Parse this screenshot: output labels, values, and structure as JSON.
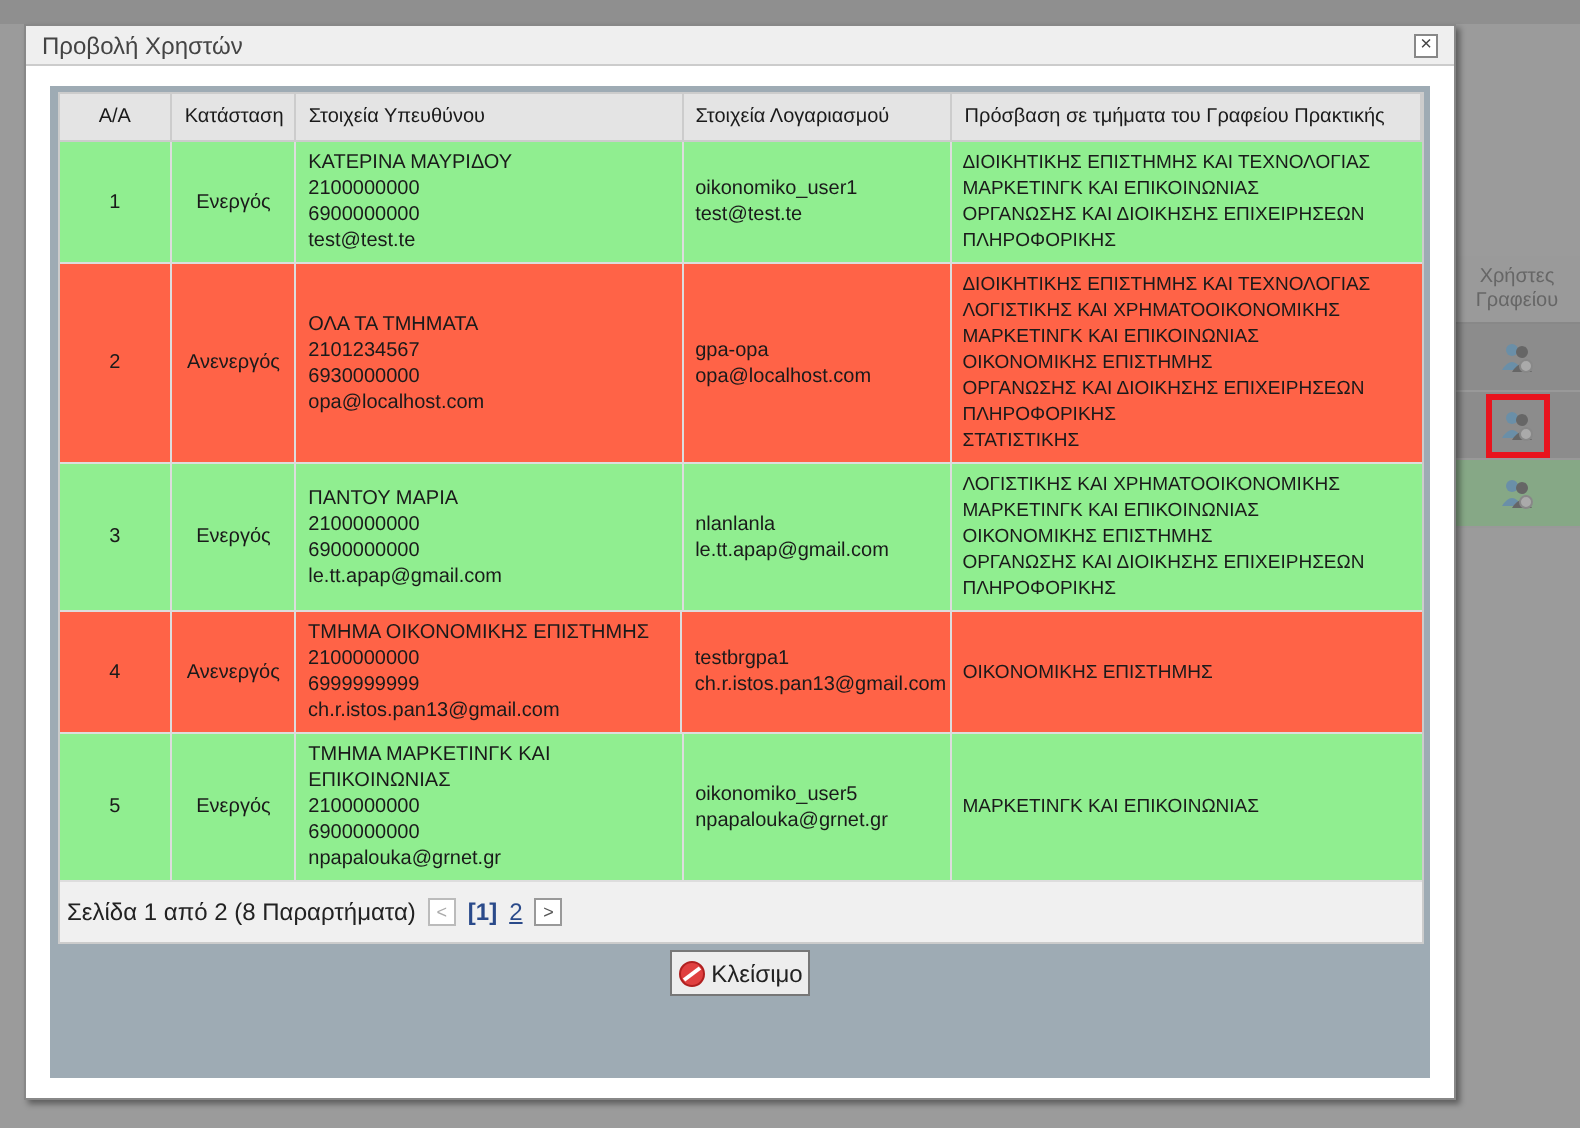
{
  "background": {
    "column_header": "Χρήστες Γραφείου",
    "rows": [
      {
        "highlighted": false,
        "color": "#8c8c8c"
      },
      {
        "highlighted": true,
        "color": "#8c8c8c"
      },
      {
        "highlighted": false,
        "color": "#86a886"
      }
    ]
  },
  "dialog": {
    "title": "Προβολή Χρηστών",
    "close_icon": "×",
    "table": {
      "columns": [
        "A/A",
        "Κατάσταση",
        "Στοιχεία Υπευθύνου",
        "Στοιχεία Λογαριασμού",
        "Πρόσβαση σε τμήματα του Γραφείου Πρακτικής"
      ],
      "rows": [
        {
          "number": "1",
          "status": "Ενεργός",
          "active": true,
          "contact": [
            "ΚΑΤΕΡΙΝΑ ΜΑΥΡΙΔΟΥ",
            "2100000000",
            "6900000000",
            "test@test.te"
          ],
          "account": [
            "oikonomiko_user1",
            "test@test.te"
          ],
          "departments": [
            "ΔΙΟΙΚΗΤΙΚΗΣ ΕΠΙΣΤΗΜΗΣ ΚΑΙ ΤΕΧΝΟΛΟΓΙΑΣ",
            "ΜΑΡΚΕΤΙΝΓΚ ΚΑΙ ΕΠΙΚΟΙΝΩΝΙΑΣ",
            "ΟΡΓΑΝΩΣΗΣ ΚΑΙ ΔΙΟΙΚΗΣΗΣ ΕΠΙΧΕΙΡΗΣΕΩΝ",
            "ΠΛΗΡΟΦΟΡΙΚΗΣ"
          ]
        },
        {
          "number": "2",
          "status": "Ανενεργός",
          "active": false,
          "contact": [
            "ΟΛΑ ΤΑ ΤΜΗΜΑΤΑ",
            "2101234567",
            "6930000000",
            "opa@localhost.com"
          ],
          "account": [
            "gpa-opa",
            "opa@localhost.com"
          ],
          "departments": [
            "ΔΙΟΙΚΗΤΙΚΗΣ ΕΠΙΣΤΗΜΗΣ ΚΑΙ ΤΕΧΝΟΛΟΓΙΑΣ",
            "ΛΟΓΙΣΤΙΚΗΣ ΚΑΙ ΧΡΗΜΑΤΟΟΙΚΟΝΟΜΙΚΗΣ",
            "ΜΑΡΚΕΤΙΝΓΚ ΚΑΙ ΕΠΙΚΟΙΝΩΝΙΑΣ",
            "ΟΙΚΟΝΟΜΙΚΗΣ ΕΠΙΣΤΗΜΗΣ",
            "ΟΡΓΑΝΩΣΗΣ ΚΑΙ ΔΙΟΙΚΗΣΗΣ ΕΠΙΧΕΙΡΗΣΕΩΝ",
            "ΠΛΗΡΟΦΟΡΙΚΗΣ",
            "ΣΤΑΤΙΣΤΙΚΗΣ"
          ]
        },
        {
          "number": "3",
          "status": "Ενεργός",
          "active": true,
          "contact": [
            "ΠΑΝΤΟΥ ΜΑΡΙΑ",
            "2100000000",
            "6900000000",
            "le.tt.apap@gmail.com"
          ],
          "account": [
            "nlanlanla",
            "le.tt.apap@gmail.com"
          ],
          "departments": [
            "ΛΟΓΙΣΤΙΚΗΣ ΚΑΙ ΧΡΗΜΑΤΟΟΙΚΟΝΟΜΙΚΗΣ",
            "ΜΑΡΚΕΤΙΝΓΚ ΚΑΙ ΕΠΙΚΟΙΝΩΝΙΑΣ",
            "ΟΙΚΟΝΟΜΙΚΗΣ ΕΠΙΣΤΗΜΗΣ",
            "ΟΡΓΑΝΩΣΗΣ ΚΑΙ ΔΙΟΙΚΗΣΗΣ ΕΠΙΧΕΙΡΗΣΕΩΝ",
            "ΠΛΗΡΟΦΟΡΙΚΗΣ"
          ]
        },
        {
          "number": "4",
          "status": "Ανενεργός",
          "active": false,
          "contact": [
            "ΤΜΗΜΑ ΟΙΚΟΝΟΜΙΚΗΣ ΕΠΙΣΤΗΜΗΣ",
            "2100000000",
            "6999999999",
            "ch.r.istos.pan13@gmail.com"
          ],
          "account": [
            "testbrgpa1",
            "ch.r.istos.pan13@gmail.com"
          ],
          "departments": [
            "ΟΙΚΟΝΟΜΙΚΗΣ ΕΠΙΣΤΗΜΗΣ"
          ]
        },
        {
          "number": "5",
          "status": "Ενεργός",
          "active": true,
          "contact": [
            "ΤΜΗΜΑ ΜΑΡΚΕΤΙΝΓΚ ΚΑΙ ΕΠΙΚΟΙΝΩΝΙΑΣ",
            "2100000000",
            "6900000000",
            "npapalouka@grnet.gr"
          ],
          "account": [
            "oikonomiko_user5",
            "npapalouka@grnet.gr"
          ],
          "departments": [
            "ΜΑΡΚΕΤΙΝΓΚ ΚΑΙ ΕΠΙΚΟΙΝΩΝΙΑΣ"
          ]
        }
      ]
    },
    "pager": {
      "summary": "Σελίδα 1 από 2 (8 Παραρτήματα)",
      "prev": "<",
      "next": ">",
      "pages": [
        {
          "label": "[1]",
          "selected": true
        },
        {
          "label": "2",
          "selected": false
        }
      ]
    },
    "close_button": "Κλείσιμο"
  }
}
